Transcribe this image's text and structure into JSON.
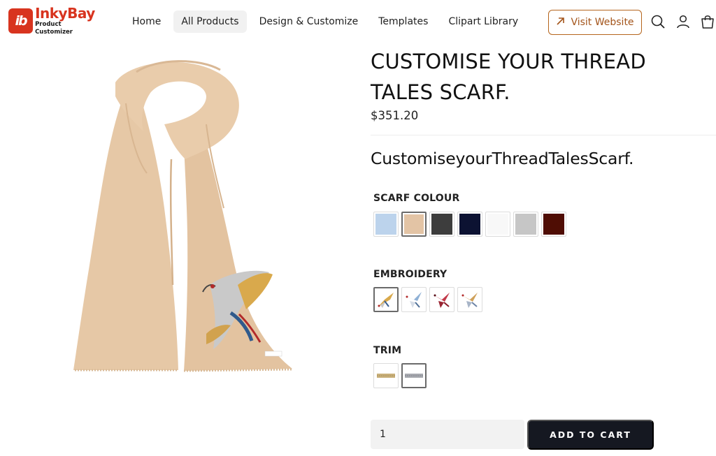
{
  "brand": {
    "logo_mark": "ib",
    "name": "InkyBay",
    "tagline": "Product Customizer"
  },
  "nav": {
    "items": [
      {
        "label": "Home",
        "active": false
      },
      {
        "label": "All Products",
        "active": true
      },
      {
        "label": "Design & Customize",
        "active": false
      },
      {
        "label": "Templates",
        "active": false
      },
      {
        "label": "Clipart Library",
        "active": false
      }
    ],
    "visit_label": "Visit Website",
    "icons": [
      "search-icon",
      "account-icon",
      "cart-icon"
    ]
  },
  "product": {
    "title": "CUSTOMISE YOUR THREAD TALES SCARF.",
    "price": "$351.20",
    "description": "CustomiseyourThreadTalesScarf.",
    "image_color": "#e8c8a8"
  },
  "options": {
    "scarf_colour": {
      "label": "SCARF COLOUR",
      "selected_index": 1,
      "colors": [
        "#bcd3ec",
        "#e3c4a5",
        "#3d3d3d",
        "#0c1232",
        "#f8f8f8",
        "#c6c6c6",
        "#4f0d04"
      ]
    },
    "embroidery": {
      "label": "EMBROIDERY",
      "selected_index": 0,
      "variants": [
        {
          "name": "gold-crane",
          "wing": "#d9a94c",
          "accent": "#3b5f8f"
        },
        {
          "name": "blue-crane",
          "wing": "#8fb1d6",
          "accent": "#4e6f97"
        },
        {
          "name": "red-crane",
          "wing": "#c2394a",
          "accent": "#8b1c2a"
        },
        {
          "name": "gold-silver-crane",
          "wing": "#cfa15a",
          "accent": "#a8b5c8"
        }
      ]
    },
    "trim": {
      "label": "TRIM",
      "selected_index": 1,
      "variants": [
        {
          "name": "gold-trim",
          "color": "#c9b07a"
        },
        {
          "name": "silver-trim",
          "color": "#a8aab0"
        }
      ]
    }
  },
  "cart": {
    "quantity": "1",
    "add_label": "ADD TO CART"
  }
}
